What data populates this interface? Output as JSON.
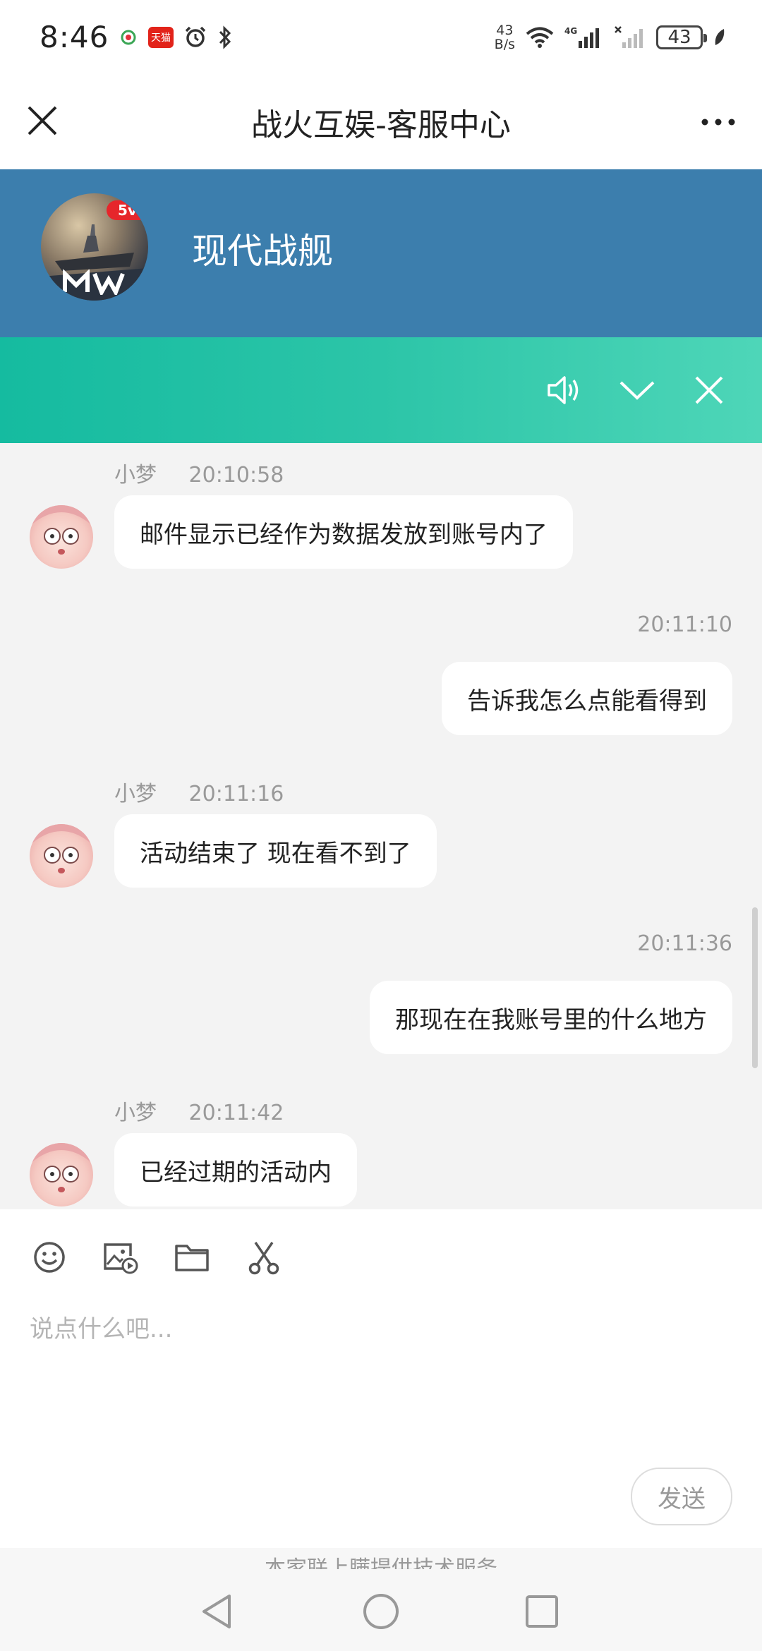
{
  "status_bar": {
    "time": "8:46",
    "net_speed_value": "43",
    "net_speed_unit": "B/s",
    "battery": "43",
    "app_icon_label": "天猫",
    "network_type": "4G"
  },
  "title_bar": {
    "title": "战火互娱-客服中心"
  },
  "game_header": {
    "name": "现代战舰",
    "badge": "5v"
  },
  "chat": {
    "messages": [
      {
        "side": "left",
        "sender": "小梦",
        "time": "20:10:58",
        "text": "邮件显示已经作为数据发放到账号内了"
      },
      {
        "side": "right",
        "time": "20:11:10",
        "text": "告诉我怎么点能看得到"
      },
      {
        "side": "left",
        "sender": "小梦",
        "time": "20:11:16",
        "text": "活动结束了 现在看不到了"
      },
      {
        "side": "right",
        "time": "20:11:36",
        "text": "那现在在我账号里的什么地方"
      },
      {
        "side": "left",
        "sender": "小梦",
        "time": "20:11:42",
        "text": "已经过期的活动内"
      }
    ]
  },
  "input": {
    "placeholder": "说点什么吧...",
    "send_label": "发送"
  },
  "footer": {
    "note": "本家联上瞒提供技术服务"
  },
  "colors": {
    "header_blue": "#3c7ead",
    "gradient_start": "#15bba0",
    "gradient_end": "#4ed6b8",
    "chat_bg": "#f3f3f3"
  }
}
